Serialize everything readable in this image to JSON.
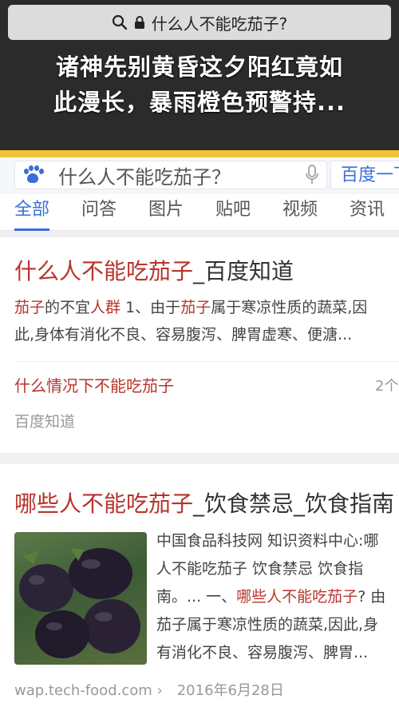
{
  "browser": {
    "address_text": "什么人不能吃茄子?"
  },
  "overlay_caption": {
    "line1": "诸神先别黄昏这夕阳红竟如",
    "line2": "此漫长，暴雨橙色预警持..."
  },
  "search": {
    "query": "什么人不能吃茄子？",
    "button_label": "百度一下"
  },
  "tabs": [
    {
      "label": "全部",
      "active": true
    },
    {
      "label": "问答"
    },
    {
      "label": "图片"
    },
    {
      "label": "贴吧"
    },
    {
      "label": "视频"
    },
    {
      "label": "资讯"
    }
  ],
  "result1": {
    "title_hl": "什么人不能吃茄子",
    "title_rest": "_百度知道",
    "line1": {
      "hl1": "茄子",
      "t1": "的不宜",
      "hl2": "人群",
      "t2": " 1、由于",
      "hl3": "茄子",
      "t3": "属于寒凉性质的蔬菜,因"
    },
    "line2": "此,身体有消化不良、容易腹泻、脾胃虚寒、便溏...",
    "sub_link": "什么情况下不能吃茄子",
    "sub_count": "2个",
    "source": "百度知道"
  },
  "result2": {
    "title_hl": "哪些人不能吃茄子",
    "title_rest": "_饮食禁忌_饮食指南",
    "side": {
      "l1": "中国食品科技网 知识资料中心:哪",
      "l2": "人不能吃茄子 饮食禁忌 饮食指",
      "l3_a": "南。... 一、",
      "l3_hl": "哪些人不能吃茄子",
      "l3_b": "? 由",
      "l4": "茄子属于寒凉性质的蔬菜,因此,身",
      "l5": "有消化不良、容易腹泻、脾胃..."
    },
    "url": "wap.tech-food.com ›",
    "date": "2016年6月28日"
  },
  "icons": {
    "search": "search-icon",
    "lock": "lock-icon",
    "baidu": "baidu-paw-icon",
    "mic": "microphone-icon"
  },
  "colors": {
    "accent_blue": "#3a6fd8",
    "highlight_red": "#b8342b",
    "stripe_gold": "#f1c232"
  }
}
